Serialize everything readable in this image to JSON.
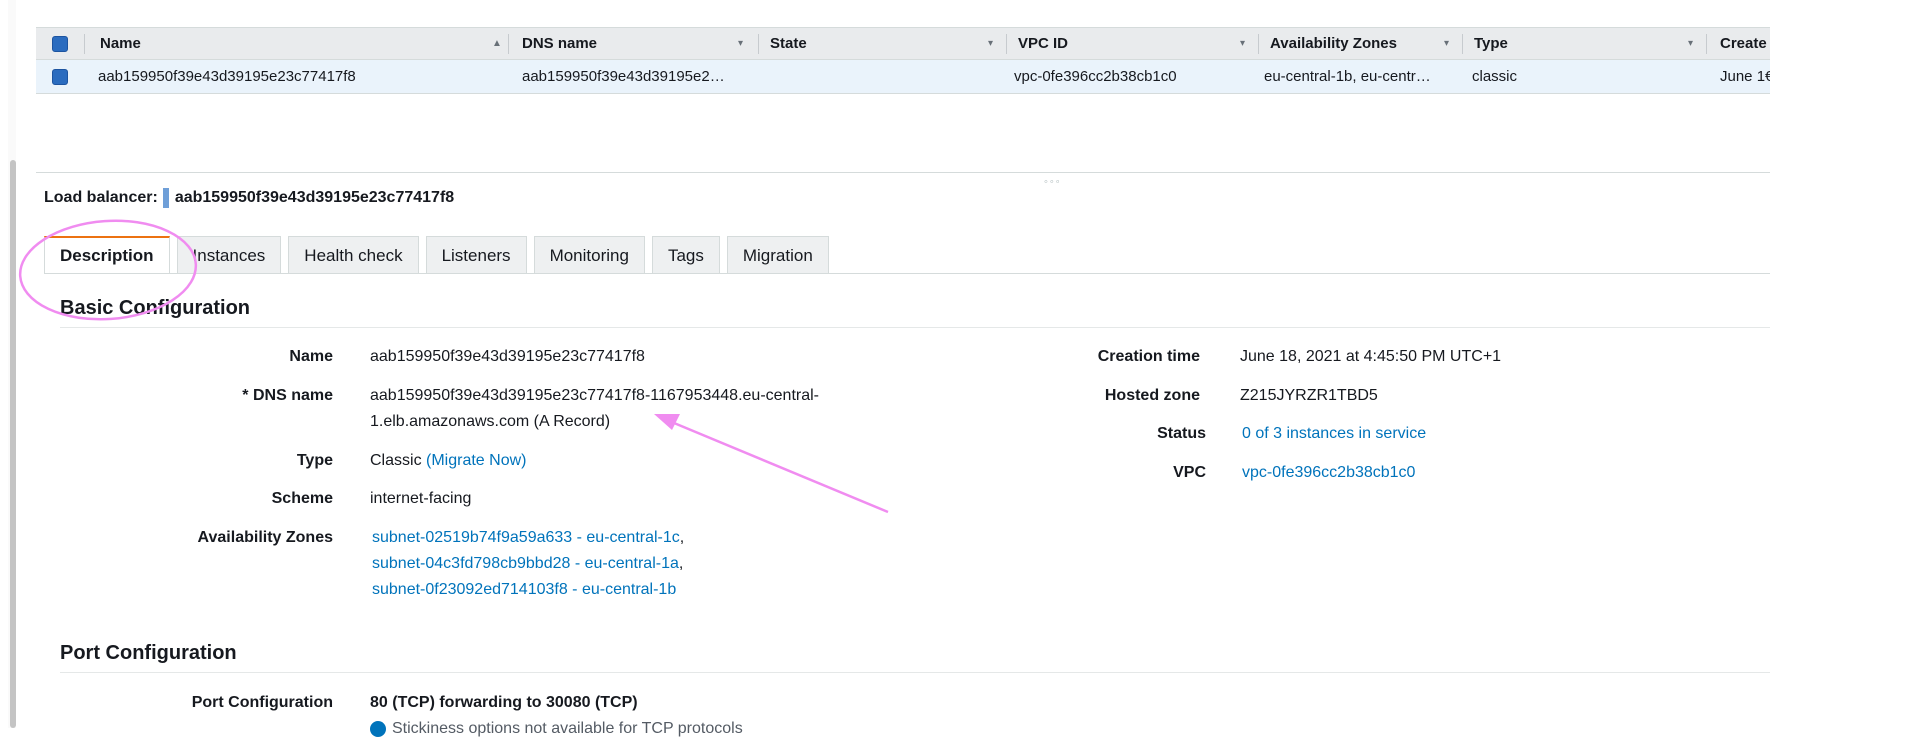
{
  "table": {
    "columns": [
      "Name",
      "DNS name",
      "State",
      "VPC ID",
      "Availability Zones",
      "Type",
      "Create"
    ],
    "row": {
      "name": "aab159950f39e43d39195e23c77417f8",
      "dns_name": "aab159950f39e43d39195e2…",
      "state": "",
      "vpc_id": "vpc-0fe396cc2b38cb1c0",
      "availability_zones": "eu-central-1b, eu-centr…",
      "type": "classic",
      "created": "June 1€"
    }
  },
  "load_balancer": {
    "label": "Load balancer:",
    "name": "aab159950f39e43d39195e23c77417f8"
  },
  "tabs": [
    "Description",
    "Instances",
    "Health check",
    "Listeners",
    "Monitoring",
    "Tags",
    "Migration"
  ],
  "basic": {
    "title": "Basic Configuration",
    "name_label": "Name",
    "name_value": "aab159950f39e43d39195e23c77417f8",
    "dns_label": "* DNS name",
    "dns_line1": "aab159950f39e43d39195e23c77417f8-1167953448.eu-central-",
    "dns_line2": "1.elb.amazonaws.com (A Record)",
    "type_label": "Type",
    "type_value": "Classic",
    "migrate_link": "(Migrate Now)",
    "scheme_label": "Scheme",
    "scheme_value": "internet-facing",
    "az_label": "Availability Zones",
    "az_items": [
      "subnet-02519b74f9a59a633 - eu-central-1c",
      "subnet-04c3fd798cb9bbd28 - eu-central-1a",
      "subnet-0f23092ed714103f8 - eu-central-1b"
    ],
    "creation_label": "Creation time",
    "creation_value": "June 18, 2021 at 4:45:50 PM UTC+1",
    "hosted_label": "Hosted zone",
    "hosted_value": "Z215JYRZR1TBD5",
    "status_label": "Status",
    "status_value": "0 of 3 instances in service",
    "vpc_label": "VPC",
    "vpc_value": "vpc-0fe396cc2b38cb1c0"
  },
  "port": {
    "title": "Port Configuration",
    "label": "Port Configuration",
    "value": "80 (TCP) forwarding to 30080 (TCP)",
    "note": "Stickiness options not available for TCP protocols"
  },
  "colors": {
    "link": "#0073bb",
    "annotation": "#f08cf0",
    "tab_accent": "#ec7211"
  }
}
